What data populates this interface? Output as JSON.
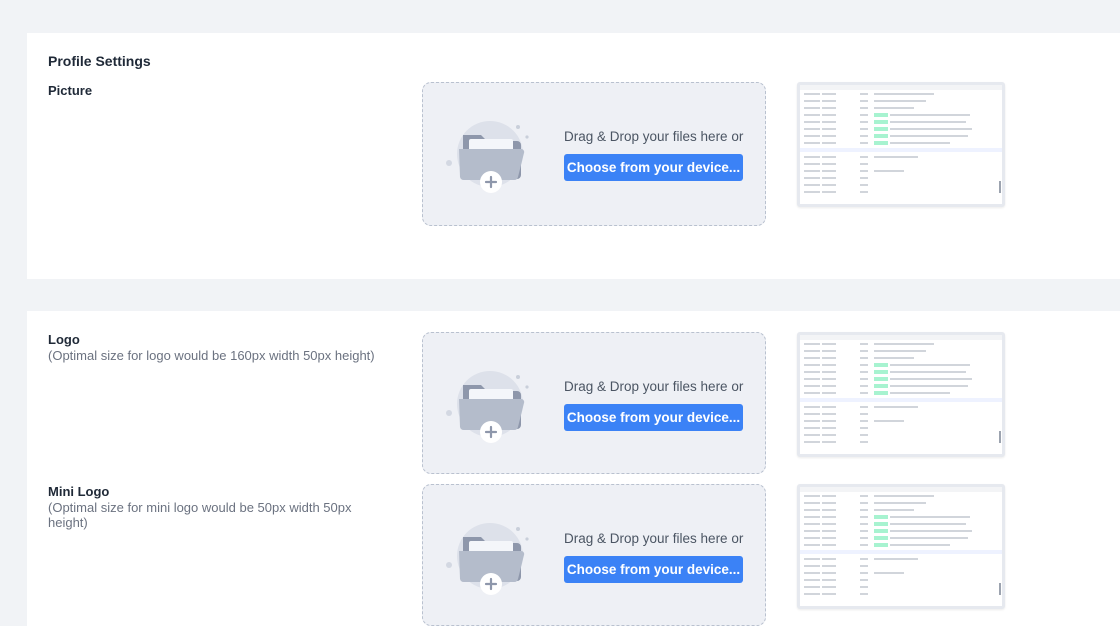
{
  "profile": {
    "title": "Profile Settings",
    "picture_label": "Picture"
  },
  "logo": {
    "label": "Logo",
    "hint": "(Optimal size for logo would be 160px width 50px height)"
  },
  "mini_logo": {
    "label": "Mini Logo",
    "hint": "(Optimal size for mini logo would be 50px width 50px height)"
  },
  "upload": {
    "drag_text": "Drag & Drop your files here or",
    "choose_label": "Choose from your device..."
  },
  "colors": {
    "page_bg": "#f1f3f6",
    "card_bg": "#ffffff",
    "accent": "#3b82f6",
    "dropzone_bg": "#eef0f5",
    "dropzone_border": "#b9c1cf"
  },
  "icons": {
    "dropzone": "folder-add-icon",
    "preview": "screenshot-preview-image"
  }
}
